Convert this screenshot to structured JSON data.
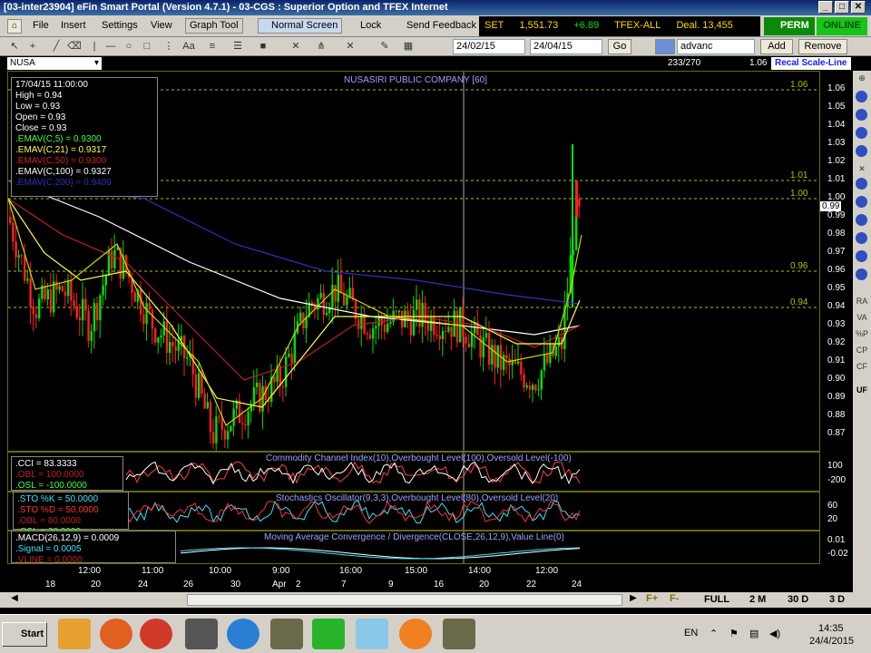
{
  "window": {
    "title": "[03-inter23904] eFin Smart Portal (Version 4.7.1) - 03-CGS : Superior Option and TFEX Internet",
    "min": "_",
    "max": "□",
    "close": "✕"
  },
  "menu": {
    "file": "File",
    "insert": "Insert",
    "settings": "Settings",
    "view": "View",
    "graph_tool": "Graph Tool",
    "normal_screen": "Normal Screen",
    "lock": "Lock",
    "send_feedback": "Send Feedback"
  },
  "market": {
    "set_label": "SET",
    "set_value": "1,551.73",
    "set_change": "+6.89",
    "tfex_label": "TFEX-ALL",
    "deal": "Deal. 13,455"
  },
  "status": {
    "perm": "PERM",
    "online": "ONLINE"
  },
  "toolbar": {
    "aa": "Aa",
    "date_from": "24/02/15",
    "date_to": "24/04/15",
    "go": "Go",
    "indicator_value": "advanc",
    "add": "Add",
    "remove": "Remove"
  },
  "symbolbar": {
    "symbol": "NUSA",
    "count": "233/270",
    "last": "1.06",
    "recal": "Recal Scale-Line"
  },
  "chart": {
    "title": "NUSASIRI PUBLIC COMPANY [60]",
    "info": {
      "datetime": "17/04/15 11:00:00",
      "high": "High  = 0.94",
      "low": "Low   = 0.93",
      "open": "Open  = 0.93",
      "close": "Close = 0.93",
      "emav5": ".EMAV(C,5)    = 0.9300",
      "emav21": ".EMAV(C,21)    = 0.9317",
      "emav50": ".EMAV(C,50)    = 0.9300",
      "emav100": ".EMAV(C,100)  = 0.9327",
      "emav200": ".EMAV(C,200)  = 0.9409"
    },
    "hlines": [
      "1.06",
      "1.01",
      "1.00",
      "0.96",
      "0.94"
    ],
    "last_price_tag": "0.99",
    "yaxis": [
      "1.06",
      "1.05",
      "1.04",
      "1.03",
      "1.02",
      "1.01",
      "1.00",
      "0.99",
      "0.98",
      "0.97",
      "0.96",
      "0.95",
      "0.94",
      "0.93",
      "0.92",
      "0.91",
      "0.90",
      "0.89",
      "0.88",
      "0.87"
    ]
  },
  "cci": {
    "title": "Commodity Channel Index(10),Overbought Level(100),Oversold Level(-100)",
    "v1": ".CCI    = 83.3333",
    "v2": ".OBL    = 100.0000",
    "v3": ".OSL    = -100.0000",
    "y": [
      "100",
      "-200"
    ]
  },
  "sto": {
    "title": "Stochastics Oscillator(9,3,3),Overbought Level(80),Oversold Level(20)",
    "v1": ".STO %K   = 50.0000",
    "v2": ".STO %D   = 50.0000",
    "v3": ".OBL    = 80.0000",
    "v4": ".OSL    = 20.0000",
    "y": [
      "60",
      "20"
    ]
  },
  "macd": {
    "title": "Moving Average Convergence / Divergence(CLOSE,26,12,9),Value Line(0)",
    "v1": ".MACD(26,12,9)  = 0.0009",
    "v2": ".Signal  = 0.0005",
    "v3": ".VLINE   = 0.0000",
    "y": [
      "0.01",
      "-0.02"
    ]
  },
  "timeaxis": {
    "times": [
      "12:00",
      "11:00",
      "10:00",
      "9:00",
      "16:00",
      "15:00",
      "14:00",
      "12:00"
    ],
    "days": [
      "18",
      "20",
      "24",
      "26",
      "30",
      "Apr",
      "2",
      "7",
      "9",
      "16",
      "20",
      "22",
      "24"
    ]
  },
  "scroll": {
    "full": "FULL",
    "m2": "2 M",
    "d30": "30 D",
    "d3": "3 D"
  },
  "taskbar": {
    "start": "Start",
    "lang": "EN",
    "time": "14:35",
    "date": "24/4/2015"
  },
  "colors": {
    "up": "#00e000",
    "down": "#ff2020",
    "ema5": "#c8d800",
    "ema21": "#ffff40",
    "ema50": "#c02020",
    "ema100": "#ffffff",
    "ema200": "#3030c0",
    "grid": "#b0c000"
  }
}
